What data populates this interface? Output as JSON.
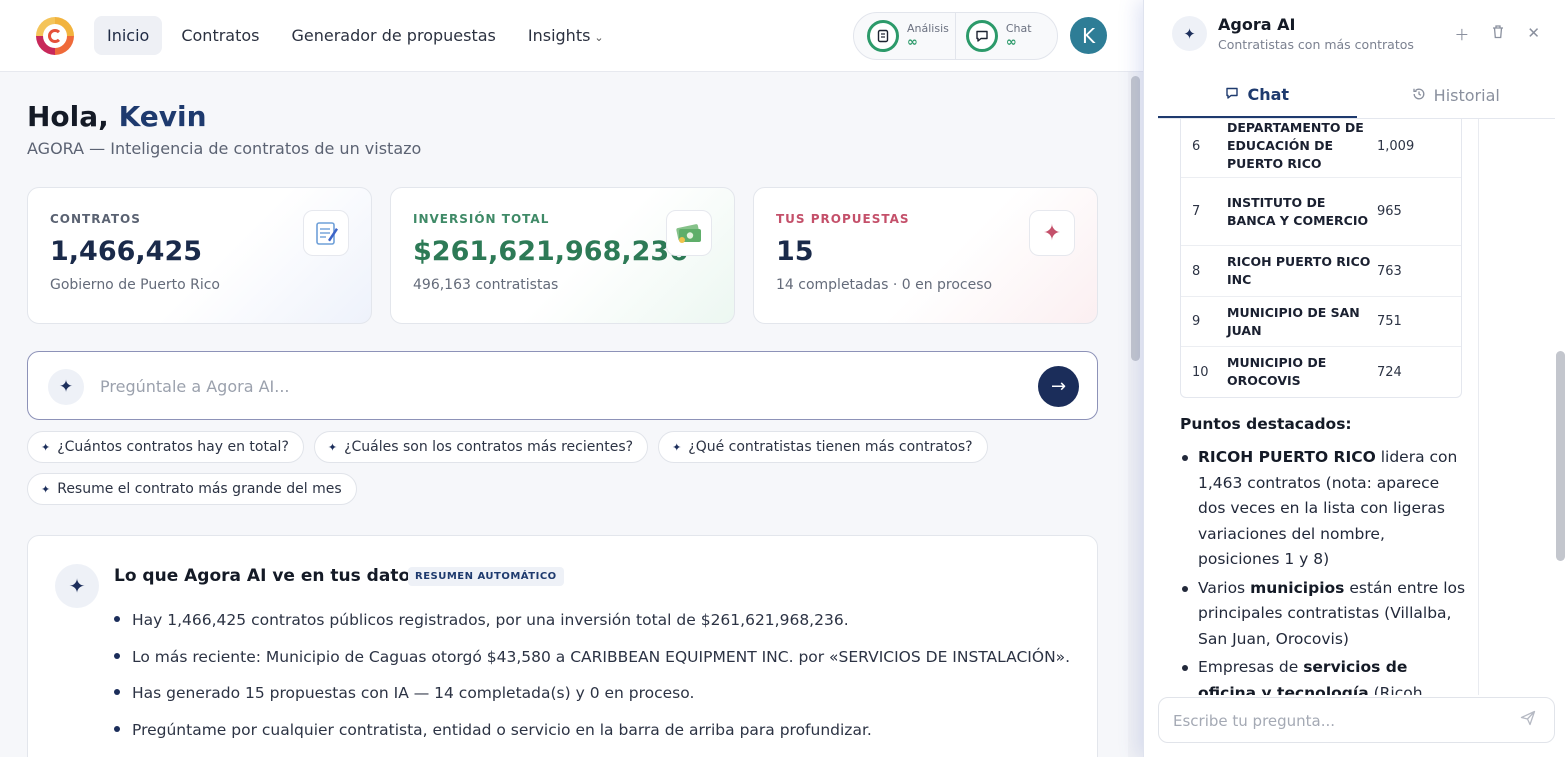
{
  "nav": {
    "items": [
      {
        "label": "Inicio",
        "active": true
      },
      {
        "label": "Contratos"
      },
      {
        "label": "Generador de propuestas"
      },
      {
        "label": "Insights",
        "dropdown": true
      }
    ]
  },
  "usage": {
    "analysis_label": "Análisis",
    "analysis_value": "∞",
    "chat_label": "Chat",
    "chat_value": "∞"
  },
  "user": {
    "initial": "K"
  },
  "hero": {
    "greeting": "Hola,",
    "name": "Kevin",
    "subtitle": "AGORA — Inteligencia de contratos de un vistazo"
  },
  "stats": [
    {
      "label": "CONTRATOS",
      "value": "1,466,425",
      "sub": "Gobierno de Puerto Rico",
      "icon": "memo-icon"
    },
    {
      "label": "INVERSIÓN TOTAL",
      "value": "$261,621,968,236",
      "sub": "496,163 contratistas",
      "icon": "money-icon"
    },
    {
      "label": "TUS PROPUESTAS",
      "value": "15",
      "sub": "14 completadas · 0 en proceso",
      "icon": "sparkle-icon"
    }
  ],
  "ask": {
    "placeholder": "Pregúntale a Agora AI..."
  },
  "suggestions": [
    "¿Cuántos contratos hay en total?",
    "¿Cuáles son los contratos más recientes?",
    "¿Qué contratistas tienen más contratos?",
    "Resume el contrato más grande del mes"
  ],
  "insight": {
    "title": "Lo que Agora AI ve en tus datos",
    "badge": "RESUMEN AUTOMÁTICO",
    "bullets": [
      "Hay 1,466,425 contratos públicos registrados, por una inversión total de $261,621,968,236.",
      "Lo más reciente: Municipio de Caguas otorgó $43,580 a CARIBBEAN EQUIPMENT INC. por «SERVICIOS DE INSTALACIÓN».",
      "Has generado 15 propuestas con IA — 14 completada(s) y 0 en proceso.",
      "Pregúntame por cualquier contratista, entidad o servicio en la barra de arriba para profundizar."
    ]
  },
  "panel": {
    "title": "Agora AI",
    "subtitle": "Contratistas con más contratos",
    "tabs": [
      {
        "label": "Chat",
        "active": true
      },
      {
        "label": "Historial"
      }
    ],
    "ranking": [
      {
        "rank": "6",
        "name": "DEPARTAMENTO DE EDUCACIÓN DE PUERTO RICO",
        "count": "1,009"
      },
      {
        "rank": "7",
        "name": "INSTITUTO DE BANCA Y COMERCIO",
        "count": "965"
      },
      {
        "rank": "8",
        "name": "RICOH PUERTO RICO INC",
        "count": "763"
      },
      {
        "rank": "9",
        "name": "MUNICIPIO DE SAN JUAN",
        "count": "751"
      },
      {
        "rank": "10",
        "name": "MUNICIPIO DE OROCOVIS",
        "count": "724"
      }
    ],
    "highlights_title": "Puntos destacados:",
    "highlights": [
      {
        "bold": "RICOH PUERTO RICO",
        "text": " lidera con 1,463 contratos (nota: aparece dos veces en la lista con ligeras variaciones del nombre, posiciones 1 y 8)"
      },
      {
        "pre": "Varios ",
        "bold": "municipios",
        "text": " están entre los principales contratistas (Villalba, San Juan, Orocovis)"
      },
      {
        "pre": "Empresas de ",
        "bold": "servicios de oficina y tecnología",
        "text": " (Ricoh, Xerox) tienen"
      }
    ],
    "input_placeholder": "Escribe tu pregunta..."
  }
}
